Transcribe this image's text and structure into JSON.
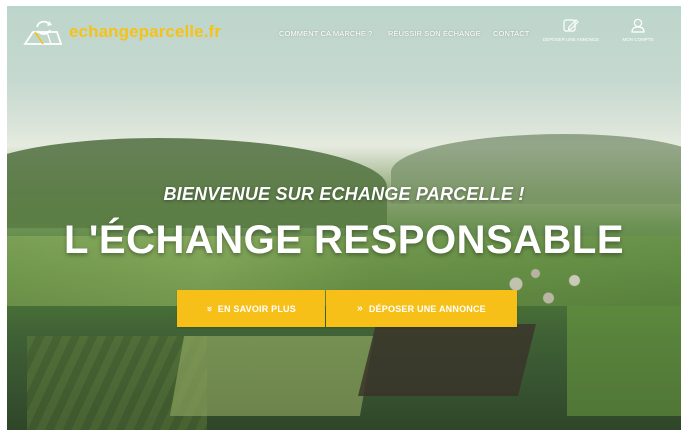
{
  "brand": {
    "name": "echangeparcelle.fr",
    "color": "#f5c21a",
    "logo_icon": "land-parcel-exchange-icon"
  },
  "nav": {
    "links": [
      {
        "label": "COMMENT CA MARCHE ?"
      },
      {
        "label": "RÉUSSIR SON ÉCHANGE"
      },
      {
        "label": "CONTACT"
      }
    ],
    "icon_items": [
      {
        "label": "DÉPOSER UNE ANNONCE",
        "icon": "edit-icon"
      },
      {
        "label": "MON COMPTE",
        "icon": "user-icon"
      }
    ]
  },
  "hero": {
    "subtitle": "BIENVENUE SUR ECHANGE PARCELLE !",
    "title": "L'ÉCHANGE RESPONSABLE",
    "buttons": [
      {
        "label": "EN SAVOIR PLUS",
        "icon": "double-chevron-down-icon",
        "glyph": "»"
      },
      {
        "label": "DÉPOSER UNE ANNONCE",
        "icon": "double-chevron-right-icon",
        "glyph": "»"
      }
    ],
    "button_color": "#f6c019"
  }
}
